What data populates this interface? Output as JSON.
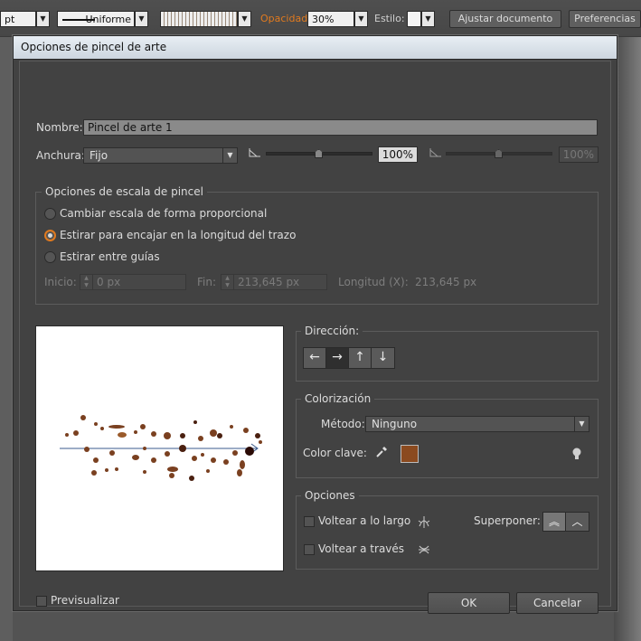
{
  "toolbar": {
    "stroke_unit": "pt",
    "profile_label": "Uniforme",
    "opacity_label": "Opacidad:",
    "opacity_value": "30%",
    "style_label": "Estilo:",
    "ajustar_button": "Ajustar documento",
    "prefs_button": "Preferencias",
    "accent_color": "#e07a1f"
  },
  "dialog": {
    "title": "Opciones de pincel de arte",
    "nombre_label": "Nombre:",
    "nombre_value": "Pincel de arte 1",
    "anchura_label": "Anchura:",
    "anchura_value": "Fijo",
    "anchura_pct": "100%",
    "anchura_pct2": "100%",
    "escala": {
      "title": "Opciones de escala de pincel",
      "options": [
        "Cambiar escala de forma proporcional",
        "Estirar para encajar en la longitud del trazo",
        "Estirar entre guías"
      ],
      "selected_index": 1,
      "inicio_label": "Inicio:",
      "inicio_value": "0 px",
      "fin_label": "Fin:",
      "fin_value": "213,645 px",
      "longitud_label": "Longitud (X):",
      "longitud_value": "213,645 px"
    },
    "direccion": {
      "title": "Dirección:",
      "icons": [
        "arrow-left-icon",
        "arrow-right-icon",
        "arrow-up-icon",
        "arrow-down-icon"
      ],
      "selected_index": 1
    },
    "colorizacion": {
      "title": "Colorización",
      "metodo_label": "Método:",
      "metodo_value": "Ninguno",
      "color_clave_label": "Color clave:",
      "key_color": "#8b4a1f"
    },
    "opciones": {
      "title": "Opciones",
      "voltear_largo": "Voltear a lo largo",
      "voltear_traves": "Voltear a través",
      "superponer_label": "Superponer:"
    },
    "previsualizar_label": "Previsualizar",
    "ok_button": "OK",
    "cancel_button": "Cancelar"
  }
}
